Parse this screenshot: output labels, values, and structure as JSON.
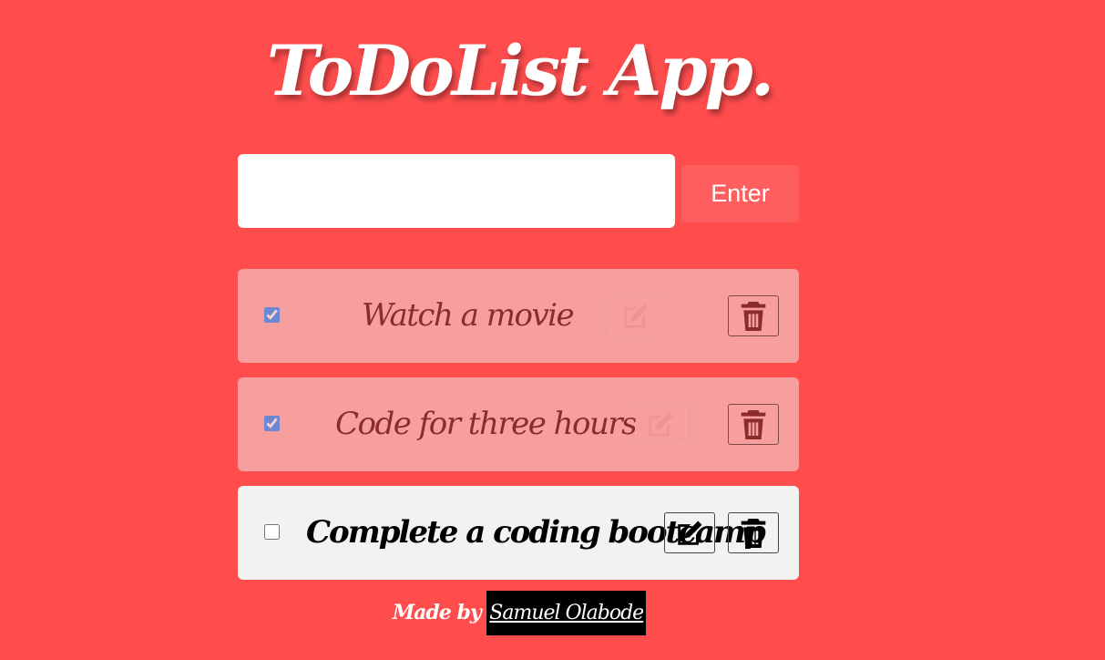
{
  "app": {
    "title": "ToDoList App."
  },
  "input": {
    "value": "",
    "placeholder": ""
  },
  "enter_button": {
    "label": "Enter"
  },
  "todos": [
    {
      "text": "Watch a movie",
      "completed": true
    },
    {
      "text": "Code for three hours",
      "completed": true
    },
    {
      "text": "Complete a coding bootcamp",
      "completed": false
    }
  ],
  "icons": {
    "edit": "edit-icon",
    "delete": "trash-icon"
  },
  "colors": {
    "background": "#ff4d4d",
    "completed_item": "#f79f9f",
    "active_item": "#f2f2f2",
    "enter_button": "#ff5e5e"
  },
  "footer": {
    "prefix": "Made by",
    "author": "Samuel Olabode"
  }
}
